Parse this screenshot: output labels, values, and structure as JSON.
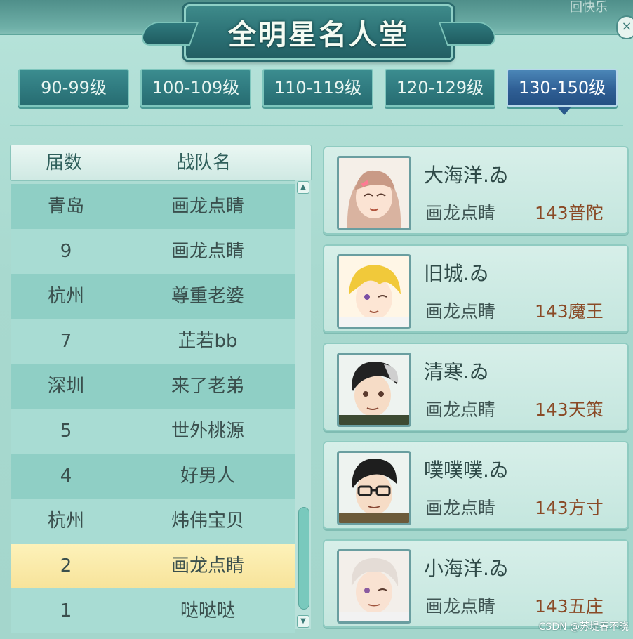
{
  "header": {
    "title": "全明星名人堂",
    "corner_text": "回快乐",
    "close_icon": "close-icon"
  },
  "tabs": [
    {
      "label": "90-99级",
      "active": false
    },
    {
      "label": "100-109级",
      "active": false
    },
    {
      "label": "110-119级",
      "active": false
    },
    {
      "label": "120-129级",
      "active": false
    },
    {
      "label": "130-150级",
      "active": true
    }
  ],
  "table": {
    "headers": [
      "届数",
      "战队名"
    ],
    "rows": [
      {
        "session": "青岛",
        "team": "画龙点睛",
        "selected": false
      },
      {
        "session": "9",
        "team": "画龙点睛",
        "selected": false
      },
      {
        "session": "杭州",
        "team": "尊重老婆",
        "selected": false
      },
      {
        "session": "7",
        "team": "芷若bb",
        "selected": false
      },
      {
        "session": "深圳",
        "team": "来了老弟",
        "selected": false
      },
      {
        "session": "5",
        "team": "世外桃源",
        "selected": false
      },
      {
        "session": "4",
        "team": "好男人",
        "selected": false
      },
      {
        "session": "杭州",
        "team": "炜伟宝贝",
        "selected": false
      },
      {
        "session": "2",
        "team": "画龙点睛",
        "selected": true
      },
      {
        "session": "1",
        "team": "哒哒哒",
        "selected": false
      }
    ]
  },
  "members": [
    {
      "name": "大海洋.ゐ",
      "team": "画龙点睛",
      "level": "143普陀",
      "avatar": "pink-hair-girl-avatar"
    },
    {
      "name": "旧城.ゐ",
      "team": "画龙点睛",
      "level": "143魔王",
      "avatar": "blonde-boy-avatar"
    },
    {
      "name": "清寒.ゐ",
      "team": "画龙点睛",
      "level": "143天策",
      "avatar": "dark-hair-boy-avatar"
    },
    {
      "name": "噗噗噗.ゐ",
      "team": "画龙点睛",
      "level": "143方寸",
      "avatar": "glasses-boy-avatar"
    },
    {
      "name": "小海洋.ゐ",
      "team": "画龙点睛",
      "level": "143五庄",
      "avatar": "silver-hair-avatar"
    }
  ],
  "watermark": "CSDN @苏堤春不晓"
}
